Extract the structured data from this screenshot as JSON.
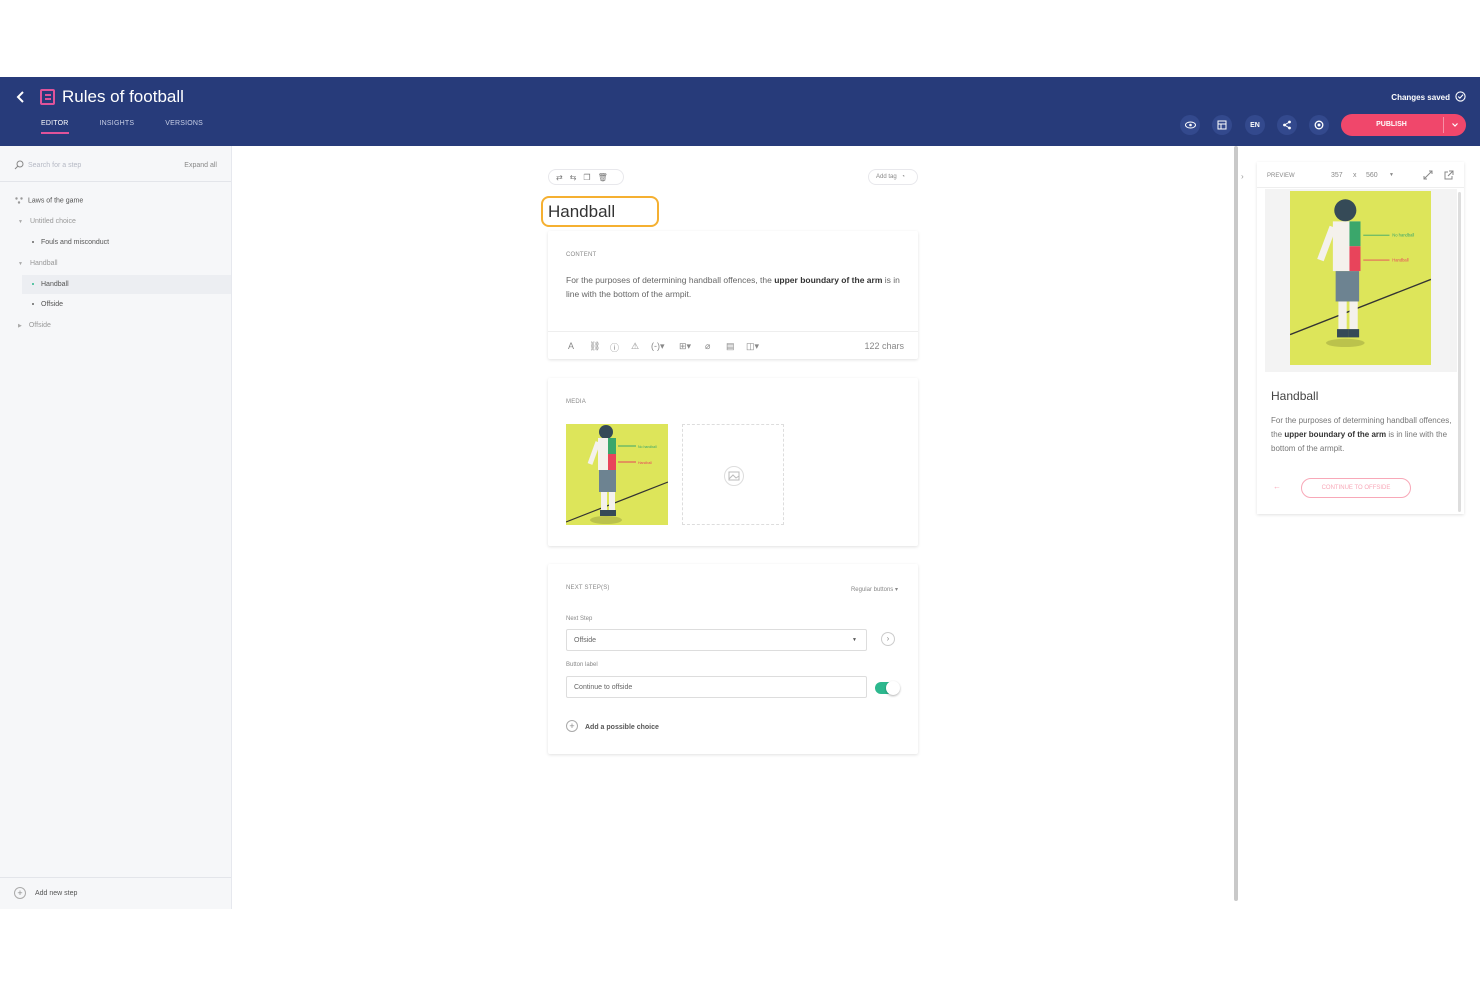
{
  "header": {
    "title": "Rules of football",
    "tabs": [
      {
        "label": "EDITOR",
        "active": true
      },
      {
        "label": "INSIGHTS",
        "active": false
      },
      {
        "label": "VERSIONS",
        "active": false
      }
    ],
    "status": "Changes saved",
    "lang": "EN",
    "publish_label": "PUBLISH",
    "colors": {
      "bar": "#273b7a",
      "accent": "#e0539a",
      "publish": "#f0476b"
    }
  },
  "sidebar": {
    "search_placeholder": "Search for a step",
    "expand_label": "Expand all",
    "tree": [
      {
        "label": "Laws of the game",
        "level": 0,
        "kind": "root"
      },
      {
        "label": "Untitled choice",
        "level": 0,
        "kind": "group"
      },
      {
        "label": "Fouls and misconduct",
        "level": 1,
        "kind": "step"
      },
      {
        "label": "Handball",
        "level": 0,
        "kind": "group"
      },
      {
        "label": "Handball",
        "level": 1,
        "kind": "step",
        "selected": true
      },
      {
        "label": "Offside",
        "level": 1,
        "kind": "step"
      },
      {
        "label": "Offside",
        "level": 0,
        "kind": "group"
      }
    ],
    "add_step_label": "Add new step"
  },
  "editor": {
    "add_tag_label": "Add tag",
    "step_title": "Handball",
    "content": {
      "label": "CONTENT",
      "text_before": "For the purposes of determining handball offences, the ",
      "text_bold": "upper boundary of the arm",
      "text_after": " is in line with the bottom of the armpit.",
      "chars": "122 chars"
    },
    "media": {
      "label": "MEDIA",
      "image_labels": [
        "No handball",
        "Handball"
      ]
    },
    "next_steps": {
      "label": "NEXT STEP(S)",
      "mode": "Regular buttons",
      "next_step_label": "Next Step",
      "next_step_value": "Offside",
      "button_label_label": "Button label",
      "button_label_value": "Continue to offside",
      "toggle_on": true,
      "add_choice_label": "Add a possible choice"
    }
  },
  "preview": {
    "label": "PREVIEW",
    "width": "357",
    "times": "x",
    "height": "560",
    "title": "Handball",
    "text_before": "For the purposes of determining handball offences, the ",
    "text_bold": "upper boundary of the arm",
    "text_after": " is in line with the bottom of the armpit.",
    "back_arrow": "←",
    "cta_label": "CONTINUE TO OFFSIDE"
  }
}
